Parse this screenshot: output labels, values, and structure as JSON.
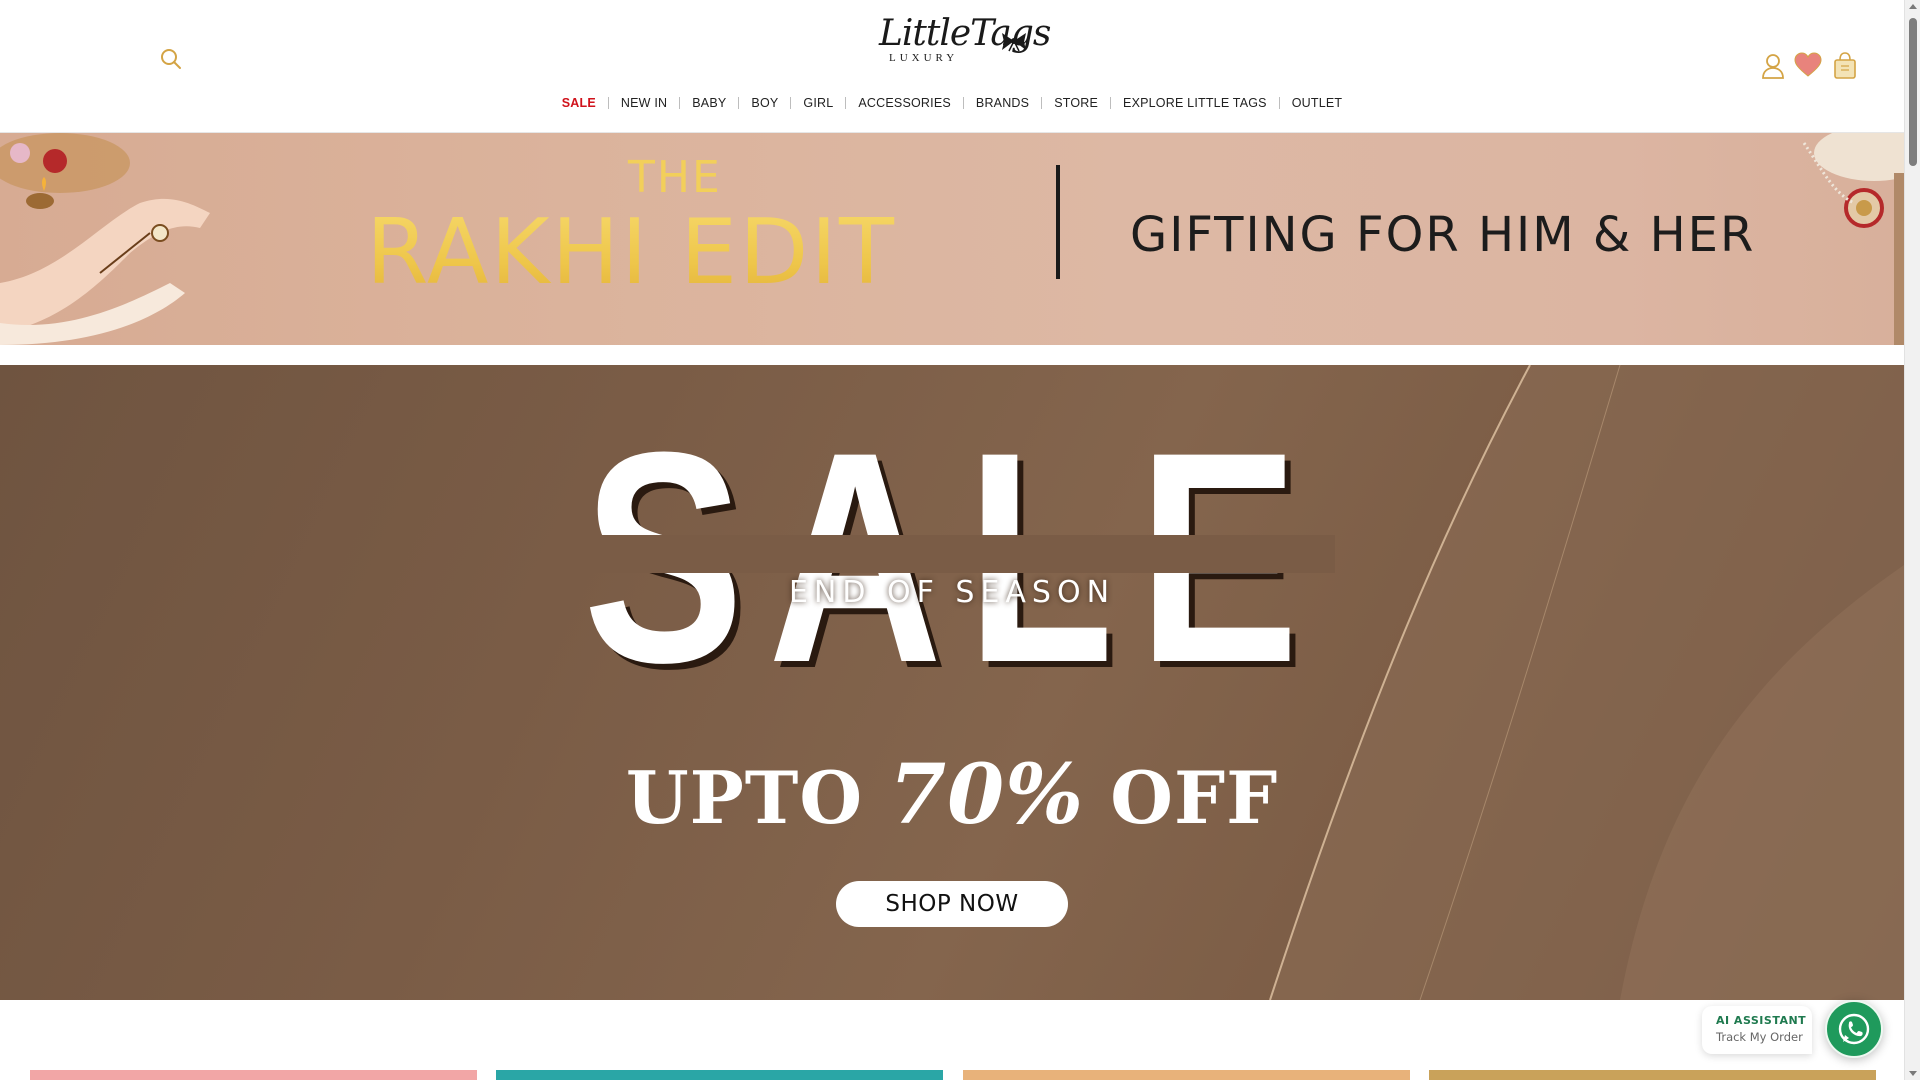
{
  "header": {
    "logo": {
      "script": "LittleTags",
      "sub": "LUXURY"
    },
    "icons": {
      "search": "search-icon",
      "account": "user-icon",
      "wishlist": "heart-icon",
      "cart": "shopping-bag-icon"
    }
  },
  "nav": {
    "items": [
      {
        "label": "SALE",
        "highlight": true
      },
      {
        "label": "NEW IN"
      },
      {
        "label": "BABY"
      },
      {
        "label": "BOY"
      },
      {
        "label": "GIRL"
      },
      {
        "label": "ACCESSORIES"
      },
      {
        "label": "BRANDS"
      },
      {
        "label": "STORE"
      },
      {
        "label": "EXPLORE LITTLE TAGS"
      },
      {
        "label": "OUTLET"
      }
    ]
  },
  "rakhi_banner": {
    "the": "THE",
    "title": "RAKHI EDIT",
    "tagline": "GIFTING FOR HIM & HER"
  },
  "hero": {
    "sale_word": "SALE",
    "subtitle": "END OF SEASON",
    "offer_prefix": "UPTO",
    "offer_value": "70%",
    "offer_suffix": "OFF",
    "cta": "SHOP NOW"
  },
  "widgets": {
    "ai_title": "AI ASSISTANT",
    "ai_sub": "Track My Order",
    "whatsapp_icon": "whatsapp-icon"
  },
  "colors": {
    "sale_red": "#d0121b",
    "gold": "#f2cf5a",
    "hero_brown": "#7a5c46",
    "whatsapp_green": "#1f9a5c",
    "icon_gold": "#d4a445",
    "heart_pink": "#e8837c"
  },
  "category_cards": {
    "colors": [
      "#f2a6a6",
      "#2aa6a6",
      "#e8b27a",
      "#c9a25a"
    ]
  }
}
